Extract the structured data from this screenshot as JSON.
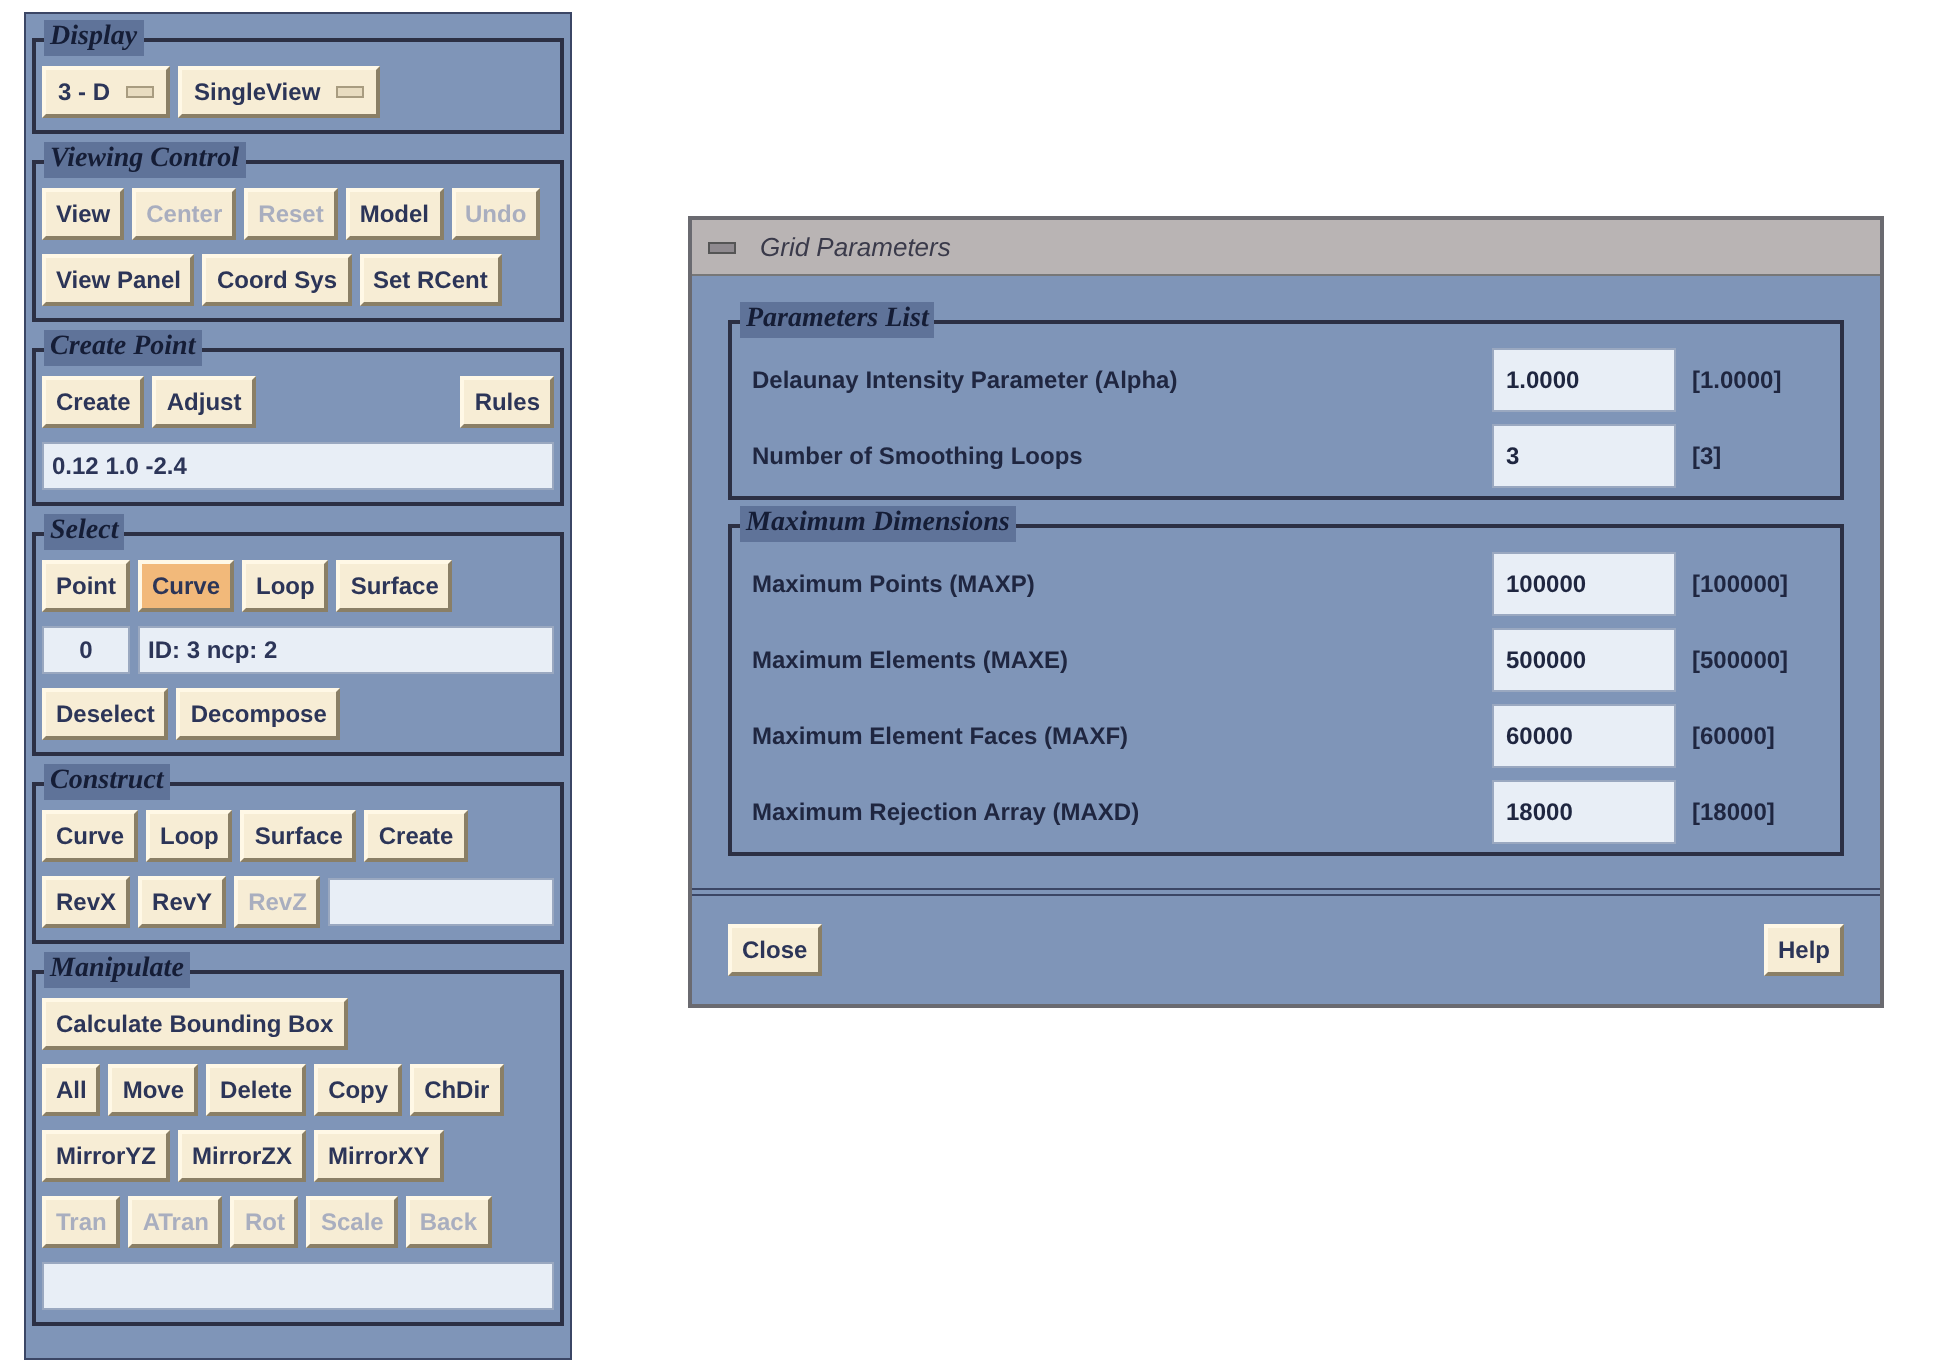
{
  "panel": {
    "sections": [
      {
        "title": "Display",
        "rows": [
          {
            "controls": [
              {
                "kind": "dropdown",
                "label": "3 - D"
              },
              {
                "kind": "dropdown",
                "label": "SingleView"
              }
            ]
          }
        ]
      },
      {
        "title": "Viewing Control",
        "rows": [
          {
            "controls": [
              {
                "kind": "button",
                "label": "View",
                "disabled": false,
                "selected": false
              },
              {
                "kind": "button",
                "label": "Center",
                "disabled": true,
                "selected": false
              },
              {
                "kind": "button",
                "label": "Reset",
                "disabled": true,
                "selected": false
              },
              {
                "kind": "button",
                "label": "Model",
                "disabled": false,
                "selected": false
              },
              {
                "kind": "button",
                "label": "Undo",
                "disabled": true,
                "selected": false
              }
            ]
          },
          {
            "controls": [
              {
                "kind": "button",
                "label": "View Panel",
                "disabled": false,
                "selected": false
              },
              {
                "kind": "button",
                "label": "Coord Sys",
                "disabled": false,
                "selected": false
              },
              {
                "kind": "button",
                "label": "Set RCent",
                "disabled": false,
                "selected": false
              }
            ]
          }
        ]
      },
      {
        "title": "Create Point",
        "rows": [
          {
            "controls": [
              {
                "kind": "button",
                "label": "Create",
                "disabled": false,
                "selected": false
              },
              {
                "kind": "button",
                "label": "Adjust",
                "disabled": false,
                "selected": false
              },
              {
                "kind": "spacer"
              },
              {
                "kind": "button",
                "label": "Rules",
                "disabled": false,
                "selected": false
              }
            ]
          },
          {
            "controls": [
              {
                "kind": "field",
                "value": "0.12  1.0  -2.4"
              }
            ]
          }
        ]
      },
      {
        "title": "Select",
        "rows": [
          {
            "controls": [
              {
                "kind": "button",
                "label": "Point",
                "disabled": false,
                "selected": false
              },
              {
                "kind": "button",
                "label": "Curve",
                "disabled": false,
                "selected": true
              },
              {
                "kind": "button",
                "label": "Loop",
                "disabled": false,
                "selected": false
              },
              {
                "kind": "button",
                "label": "Surface",
                "disabled": false,
                "selected": false
              }
            ]
          },
          {
            "controls": [
              {
                "kind": "count",
                "value": "0"
              },
              {
                "kind": "field",
                "value": "ID: 3  ncp: 2"
              }
            ]
          },
          {
            "controls": [
              {
                "kind": "button",
                "label": "Deselect",
                "disabled": false,
                "selected": false
              },
              {
                "kind": "button",
                "label": "Decompose",
                "disabled": false,
                "selected": false
              }
            ]
          }
        ]
      },
      {
        "title": "Construct",
        "rows": [
          {
            "controls": [
              {
                "kind": "button",
                "label": "Curve",
                "disabled": false,
                "selected": false
              },
              {
                "kind": "button",
                "label": "Loop",
                "disabled": false,
                "selected": false
              },
              {
                "kind": "button",
                "label": "Surface",
                "disabled": false,
                "selected": false
              },
              {
                "kind": "button",
                "label": "Create",
                "disabled": false,
                "selected": false
              }
            ]
          },
          {
            "controls": [
              {
                "kind": "button",
                "label": "RevX",
                "disabled": false,
                "selected": false
              },
              {
                "kind": "button",
                "label": "RevY",
                "disabled": false,
                "selected": false
              },
              {
                "kind": "button",
                "label": "RevZ",
                "disabled": true,
                "selected": false
              },
              {
                "kind": "field"
              }
            ]
          }
        ]
      },
      {
        "title": "Manipulate",
        "rows": [
          {
            "controls": [
              {
                "kind": "button",
                "label": "Calculate Bounding Box",
                "disabled": false,
                "selected": false
              }
            ]
          },
          {
            "controls": [
              {
                "kind": "button",
                "label": "All",
                "disabled": false,
                "selected": false
              },
              {
                "kind": "button",
                "label": "Move",
                "disabled": false,
                "selected": false
              },
              {
                "kind": "button",
                "label": "Delete",
                "disabled": false,
                "selected": false
              },
              {
                "kind": "button",
                "label": "Copy",
                "disabled": false,
                "selected": false
              },
              {
                "kind": "button",
                "label": "ChDir",
                "disabled": false,
                "selected": false
              }
            ]
          },
          {
            "controls": [
              {
                "kind": "button",
                "label": "MirrorYZ",
                "disabled": false,
                "selected": false
              },
              {
                "kind": "button",
                "label": "MirrorZX",
                "disabled": false,
                "selected": false
              },
              {
                "kind": "button",
                "label": "MirrorXY",
                "disabled": false,
                "selected": false
              }
            ]
          },
          {
            "controls": [
              {
                "kind": "button",
                "label": "Tran",
                "disabled": true,
                "selected": false
              },
              {
                "kind": "button",
                "label": "ATran",
                "disabled": true,
                "selected": false
              },
              {
                "kind": "button",
                "label": "Rot",
                "disabled": true,
                "selected": false
              },
              {
                "kind": "button",
                "label": "Scale",
                "disabled": true,
                "selected": false
              },
              {
                "kind": "button",
                "label": "Back",
                "disabled": true,
                "selected": false
              }
            ]
          },
          {
            "controls": [
              {
                "kind": "field"
              }
            ]
          }
        ]
      }
    ]
  },
  "dialog": {
    "title": "Grid Parameters",
    "groups": [
      {
        "title": "Parameters List",
        "params": [
          {
            "label": "Delaunay Intensity Parameter  (Alpha)",
            "value": "1.0000",
            "default": "[1.0000]"
          },
          {
            "label": "Number of Smoothing Loops",
            "value": "3",
            "default": "[3]"
          }
        ]
      },
      {
        "title": "Maximum Dimensions",
        "params": [
          {
            "label": "Maximum Points (MAXP)",
            "value": "100000",
            "default": "[100000]"
          },
          {
            "label": "Maximum Elements (MAXE)",
            "value": "500000",
            "default": "[500000]"
          },
          {
            "label": "Maximum Element Faces (MAXF)",
            "value": "60000",
            "default": "[60000]"
          },
          {
            "label": "Maximum Rejection Array (MAXD)",
            "value": "18000",
            "default": "[18000]"
          }
        ]
      }
    ],
    "buttons": [
      "Close",
      "Help"
    ]
  }
}
